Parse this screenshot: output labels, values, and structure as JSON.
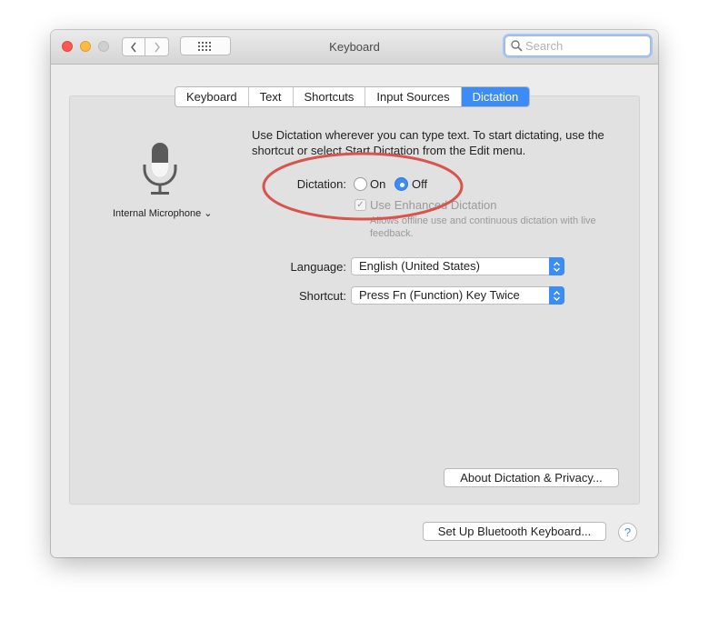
{
  "window": {
    "title": "Keyboard",
    "search_placeholder": "Search"
  },
  "tabs": [
    {
      "label": "Keyboard",
      "active": false
    },
    {
      "label": "Text",
      "active": false
    },
    {
      "label": "Shortcuts",
      "active": false
    },
    {
      "label": "Input Sources",
      "active": false
    },
    {
      "label": "Dictation",
      "active": true
    }
  ],
  "microphone": {
    "icon": "microphone-icon",
    "label": "Internal Microphone",
    "menu_glyph": "⌄"
  },
  "dictation": {
    "description": "Use Dictation wherever you can type text. To start dictating, use the shortcut or select Start Dictation from the Edit menu.",
    "label": "Dictation:",
    "on_label": "On",
    "off_label": "Off",
    "selected": "Off",
    "enhanced_label": "Use Enhanced Dictation",
    "enhanced_checked": true,
    "enhanced_enabled": false,
    "enhanced_description": "Allows offline use and continuous dictation with live feedback."
  },
  "language": {
    "label": "Language:",
    "value": "English (United States)"
  },
  "shortcut": {
    "label": "Shortcut:",
    "value": "Press Fn (Function) Key Twice"
  },
  "buttons": {
    "about": "About Dictation & Privacy...",
    "bluetooth": "Set Up Bluetooth Keyboard...",
    "help": "?"
  },
  "colors": {
    "accent": "#3b8cf5",
    "annotation": "#d9534f"
  }
}
